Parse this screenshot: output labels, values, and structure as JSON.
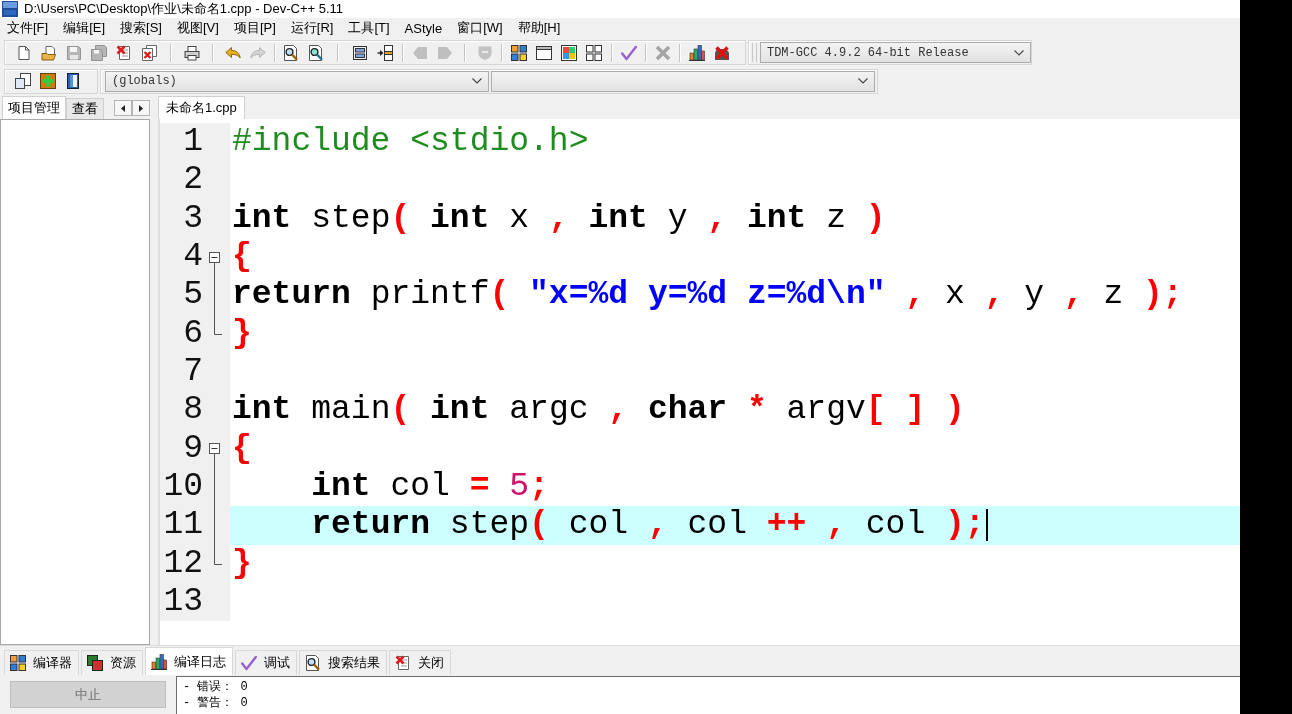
{
  "window": {
    "title": "D:\\Users\\PC\\Desktop\\作业\\未命名1.cpp - Dev-C++ 5.11"
  },
  "menu": [
    "文件[F]",
    "编辑[E]",
    "搜索[S]",
    "视图[V]",
    "项目[P]",
    "运行[R]",
    "工具[T]",
    "AStyle",
    "窗口[W]",
    "帮助[H]"
  ],
  "toolbar": [
    [
      {
        "kind": "new",
        "disabled": false
      },
      {
        "kind": "open",
        "disabled": false
      },
      {
        "kind": "save",
        "disabled": true
      },
      {
        "kind": "save-all",
        "disabled": true
      },
      {
        "kind": "close",
        "disabled": false
      },
      {
        "kind": "close-all",
        "disabled": false
      }
    ],
    [
      {
        "kind": "print",
        "disabled": false
      }
    ],
    [
      {
        "kind": "undo",
        "disabled": false
      },
      {
        "kind": "redo",
        "disabled": true
      }
    ],
    [
      {
        "kind": "find",
        "disabled": false
      },
      {
        "kind": "replace",
        "disabled": false
      }
    ],
    [
      {
        "kind": "panels",
        "disabled": false
      },
      {
        "kind": "goto",
        "disabled": false
      }
    ],
    [
      {
        "kind": "bookmark-prev",
        "disabled": true
      },
      {
        "kind": "bookmark-next",
        "disabled": true
      }
    ],
    [
      {
        "kind": "shield",
        "disabled": true
      }
    ],
    [
      {
        "kind": "compile",
        "disabled": false
      },
      {
        "kind": "run",
        "disabled": false
      },
      {
        "kind": "compile-run",
        "disabled": false
      },
      {
        "kind": "rebuild",
        "disabled": false
      }
    ],
    [
      {
        "kind": "check",
        "disabled": false
      }
    ],
    [
      {
        "kind": "clean",
        "disabled": true
      }
    ],
    [
      {
        "kind": "profile",
        "disabled": false
      },
      {
        "kind": "profile-delete",
        "disabled": false
      }
    ]
  ],
  "compiler_select": {
    "value": "TDM-GCC 4.9.2 64-bit Release"
  },
  "toolbar_2": [
    [
      {
        "kind": "new-class",
        "disabled": false
      },
      {
        "kind": "add",
        "disabled": false
      },
      {
        "kind": "book",
        "disabled": false
      }
    ]
  ],
  "scope_select": {
    "value": "(globals)"
  },
  "left_tabs": [
    {
      "label": "项目管理",
      "selected": true
    },
    {
      "label": "查看",
      "selected": false
    }
  ],
  "editor_tabs": [
    {
      "label": "未命名1.cpp",
      "selected": true
    }
  ],
  "editor": {
    "lines": [
      {
        "number": "1",
        "current": false,
        "tokens": [
          {
            "kind": "preprocessor",
            "text": "#include <stdio.h>"
          }
        ]
      },
      {
        "number": "2",
        "current": false
      },
      {
        "number": "3",
        "current": false,
        "tokens": [
          {
            "kind": "keyword",
            "text": "int"
          },
          {
            "kind": "plain",
            "text": " step"
          },
          {
            "kind": "symbol",
            "text": "( "
          },
          {
            "kind": "keyword",
            "text": "int"
          },
          {
            "kind": "plain",
            "text": " x "
          },
          {
            "kind": "symbol",
            "text": ", "
          },
          {
            "kind": "keyword",
            "text": "int"
          },
          {
            "kind": "plain",
            "text": " y "
          },
          {
            "kind": "symbol",
            "text": ", "
          },
          {
            "kind": "keyword",
            "text": "int"
          },
          {
            "kind": "plain",
            "text": " z "
          },
          {
            "kind": "symbol",
            "text": ")"
          }
        ]
      },
      {
        "number": "4",
        "current": false,
        "expanded": true,
        "tokens": [
          {
            "kind": "symbol",
            "text": "{"
          }
        ],
        "children": [
          {
            "number": "5",
            "current": false,
            "tokens": [
              {
                "kind": "keyword",
                "text": "return"
              },
              {
                "kind": "plain",
                "text": " printf"
              },
              {
                "kind": "symbol",
                "text": "( "
              },
              {
                "kind": "string",
                "text": "\"x=%d y=%d z=%d\\n\""
              },
              {
                "kind": "symbol",
                "text": " ,"
              },
              {
                "kind": "plain",
                "text": " x "
              },
              {
                "kind": "symbol",
                "text": ","
              },
              {
                "kind": "plain",
                "text": " y "
              },
              {
                "kind": "symbol",
                "text": ","
              },
              {
                "kind": "plain",
                "text": " z "
              },
              {
                "kind": "symbol",
                "text": ");"
              }
            ]
          },
          {
            "number": "6",
            "current": false,
            "tokens": [
              {
                "kind": "symbol",
                "text": "}"
              }
            ]
          }
        ]
      },
      {
        "number": "7",
        "current": false
      },
      {
        "number": "8",
        "current": false,
        "tokens": [
          {
            "kind": "keyword",
            "text": "int"
          },
          {
            "kind": "plain",
            "text": " main"
          },
          {
            "kind": "symbol",
            "text": "( "
          },
          {
            "kind": "keyword",
            "text": "int"
          },
          {
            "kind": "plain",
            "text": " argc "
          },
          {
            "kind": "symbol",
            "text": ", "
          },
          {
            "kind": "keyword",
            "text": "char"
          },
          {
            "kind": "symbol",
            "text": " *"
          },
          {
            "kind": "plain",
            "text": " argv"
          },
          {
            "kind": "symbol",
            "text": "[ ] )"
          }
        ]
      },
      {
        "number": "9",
        "current": false,
        "expanded": true,
        "tokens": [
          {
            "kind": "symbol",
            "text": "{"
          }
        ],
        "children": [
          {
            "number": "10",
            "current": false,
            "tokens": [
              {
                "kind": "keyword",
                "text": "    int"
              },
              {
                "kind": "plain",
                "text": " col "
              },
              {
                "kind": "symbol",
                "text": "= "
              },
              {
                "kind": "number",
                "text": "5"
              },
              {
                "kind": "symbol",
                "text": ";"
              }
            ]
          },
          {
            "number": "11",
            "current": true,
            "tokens": [
              {
                "kind": "keyword",
                "text": "    return"
              },
              {
                "kind": "plain",
                "text": " step"
              },
              {
                "kind": "symbol",
                "text": "("
              },
              {
                "kind": "plain",
                "text": " col "
              },
              {
                "kind": "symbol",
                "text": ","
              },
              {
                "kind": "plain",
                "text": " col "
              },
              {
                "kind": "symbol",
                "text": "++ ,"
              },
              {
                "kind": "plain",
                "text": " col "
              },
              {
                "kind": "symbol",
                "text": ");"
              }
            ]
          },
          {
            "number": "12",
            "current": false,
            "tokens": [
              {
                "kind": "symbol",
                "text": "}"
              }
            ]
          }
        ]
      },
      {
        "number": "13",
        "current": false
      }
    ]
  },
  "bottom_tabs": [
    {
      "kind": "compile",
      "label": "编译器",
      "selected": false
    },
    {
      "kind": "resources",
      "label": "资源",
      "selected": false
    },
    {
      "kind": "profile",
      "label": "编译日志",
      "selected": true
    },
    {
      "kind": "check",
      "label": "调试",
      "selected": false
    },
    {
      "kind": "find",
      "label": "搜索结果",
      "selected": false
    },
    {
      "kind": "close",
      "label": "关闭",
      "selected": false
    }
  ],
  "stop_button": {
    "label": "中止",
    "disabled": true
  },
  "log": [
    "- 错误： 0",
    "- 警告： 0"
  ]
}
